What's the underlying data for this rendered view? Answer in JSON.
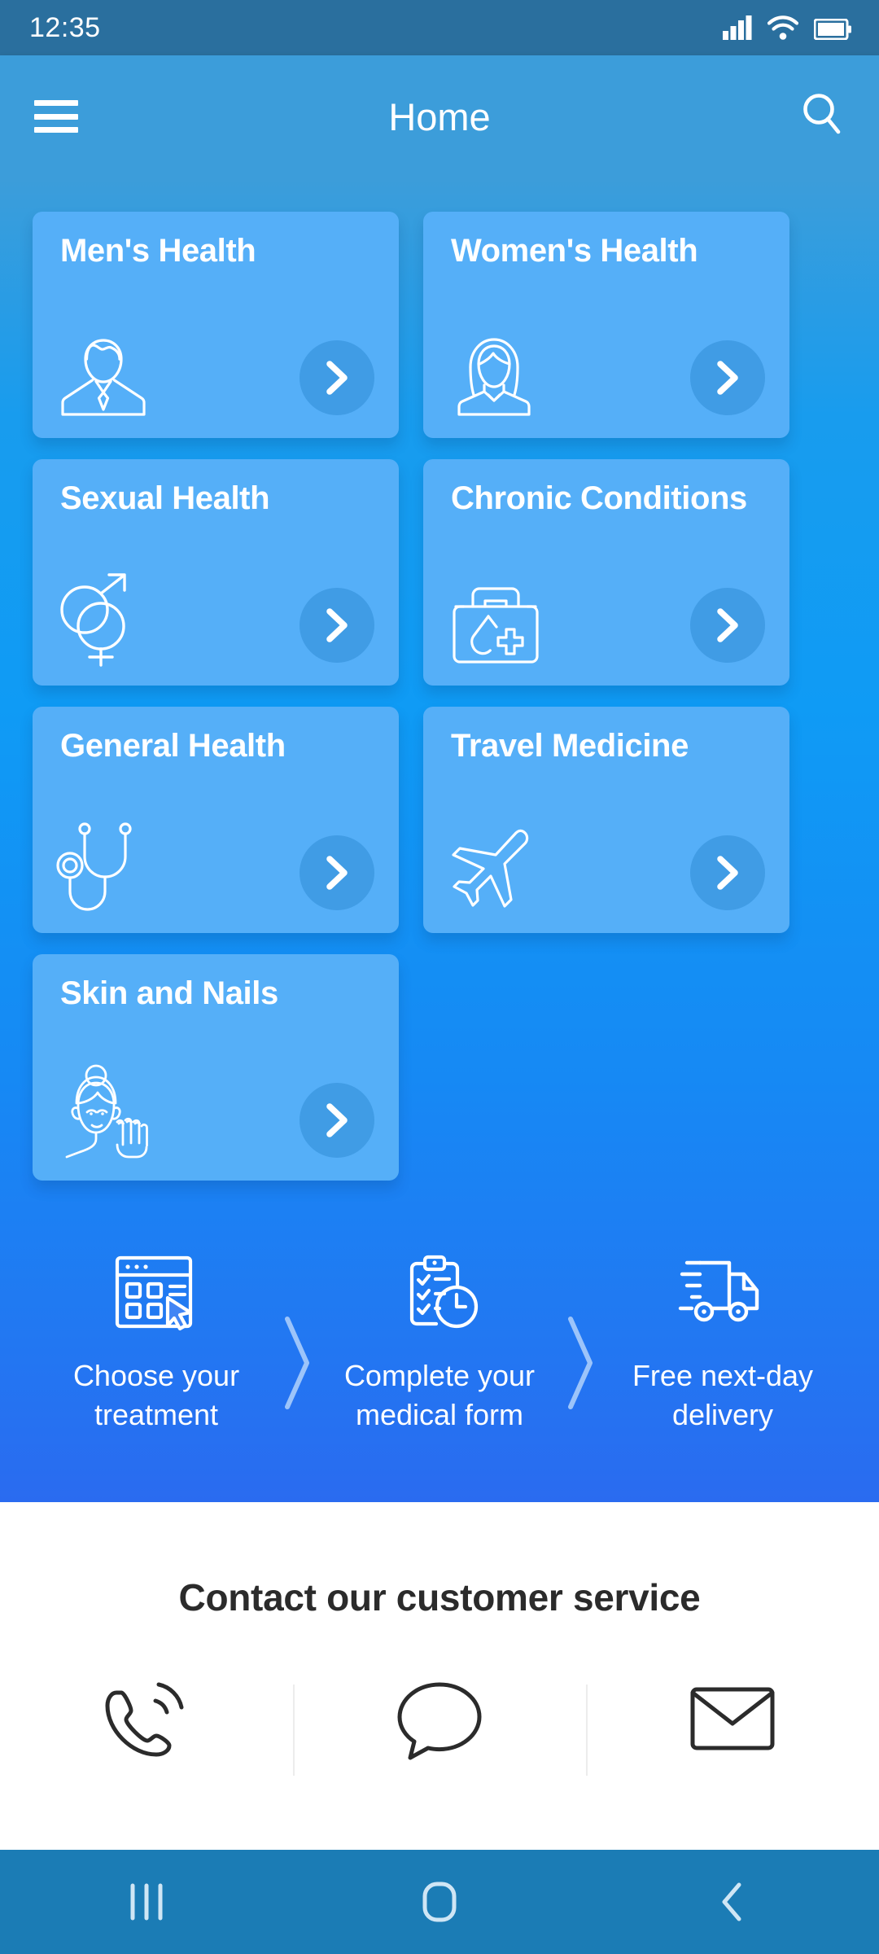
{
  "statusbar": {
    "time": "12:35",
    "icons": [
      "signal-icon",
      "wifi-icon",
      "battery-icon"
    ]
  },
  "appbar": {
    "menu_icon": "hamburger-menu-icon",
    "title": "Home",
    "search_icon": "search-icon"
  },
  "colors": {
    "statusbar_bg": "#2A6F9E",
    "appbar_bg": "#3C9DDA",
    "hero_top": "#189CEE",
    "hero_bottom": "#2A6BF0",
    "card_bg": "#55AFF8",
    "card_arrow_bg": "rgba(22,118,190,.33)",
    "navbar_bg": "#1B7CB5",
    "contact_bg": "#FFFFFF",
    "contact_title": "#2B2B2B"
  },
  "categories": [
    {
      "label": "Men's Health",
      "icon": "man-bust-icon",
      "arrow_icon": "chevron-right-icon"
    },
    {
      "label": "Women's Health",
      "icon": "woman-bust-icon",
      "arrow_icon": "chevron-right-icon"
    },
    {
      "label": "Sexual Health",
      "icon": "gender-symbols-icon",
      "arrow_icon": "chevron-right-icon"
    },
    {
      "label": "Chronic Conditions",
      "icon": "medical-bag-icon",
      "arrow_icon": "chevron-right-icon"
    },
    {
      "label": "General Health",
      "icon": "stethoscope-icon",
      "arrow_icon": "chevron-right-icon"
    },
    {
      "label": "Travel Medicine",
      "icon": "airplane-icon",
      "arrow_icon": "chevron-right-icon"
    },
    {
      "label": "Skin and Nails",
      "icon": "face-and-nails-icon",
      "arrow_icon": "chevron-right-icon"
    }
  ],
  "steps": [
    {
      "line1": "Choose your",
      "line2": "treatment",
      "icon": "browser-grid-cursor-icon"
    },
    {
      "line1": "Complete your",
      "line2": "medical form",
      "icon": "clipboard-clock-icon"
    },
    {
      "line1": "Free next-day",
      "line2": "delivery",
      "icon": "delivery-truck-icon"
    }
  ],
  "step_separator_icon": "chevron-right-thin-icon",
  "contact": {
    "title": "Contact our customer service",
    "options": [
      {
        "icon": "phone-call-icon"
      },
      {
        "icon": "chat-bubble-icon"
      },
      {
        "icon": "envelope-icon"
      }
    ]
  },
  "navbar": {
    "recents_icon": "recents-icon",
    "home_icon": "home-icon",
    "back_icon": "back-icon"
  }
}
